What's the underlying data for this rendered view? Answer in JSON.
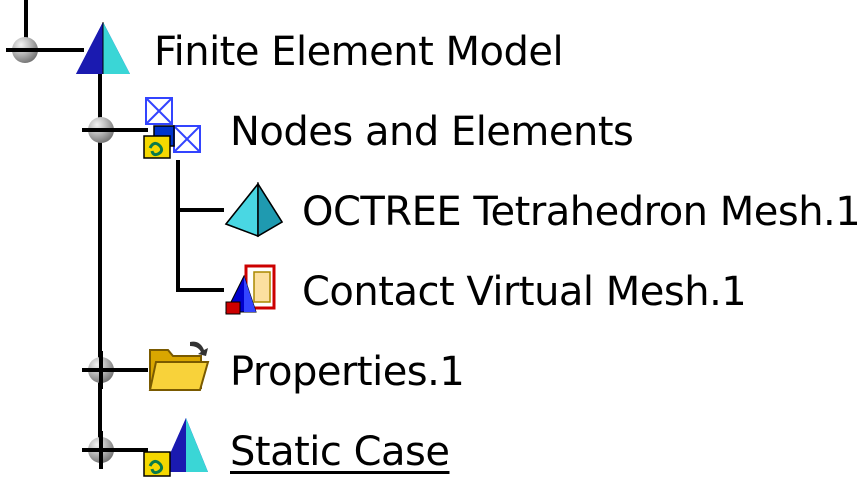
{
  "tree": {
    "root": {
      "label": "Finite Element Model",
      "icon": "fem-model-icon",
      "expander": "collapse"
    },
    "nodes_and_elements": {
      "label": "Nodes and Elements",
      "icon": "nodes-elements-icon",
      "expander": "collapse",
      "children": [
        {
          "label": "OCTREE Tetrahedron Mesh.1",
          "icon": "tetrahedron-mesh-icon"
        },
        {
          "label": "Contact Virtual Mesh.1",
          "icon": "contact-mesh-icon"
        }
      ]
    },
    "properties": {
      "label": "Properties.1",
      "icon": "folder-icon",
      "expander": "expand"
    },
    "static_case": {
      "label": "Static Case",
      "icon": "static-case-icon",
      "expander": "expand",
      "underlined": true
    }
  },
  "colors": {
    "line": "#000000",
    "model_blue": "#0000cc",
    "model_cyan": "#33cccc",
    "folder_yellow": "#f5c400"
  }
}
